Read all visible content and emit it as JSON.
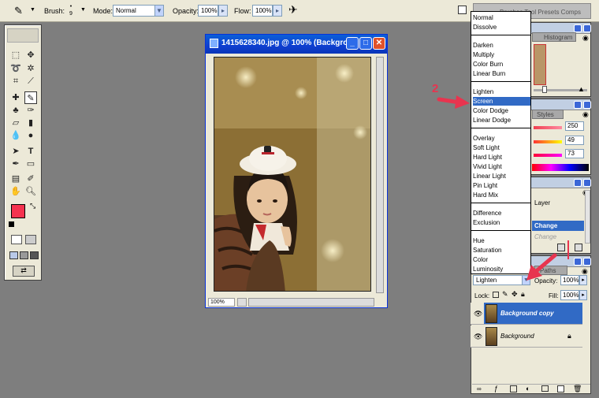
{
  "options_bar": {
    "brush_label": "Brush:",
    "brush_size": "9",
    "mode_label": "Mode:",
    "mode_value": "Normal",
    "opacity_label": "Opacity:",
    "opacity_value": "100%",
    "flow_label": "Flow:",
    "flow_value": "100%",
    "well_tabs": "Brushes  Tool Presets  Comps"
  },
  "image_window": {
    "title": "1415628340.jpg @ 100% (Backgro...",
    "zoom": "100%"
  },
  "panels": {
    "histogram_tab": "Histogram",
    "styles_tab": "Styles",
    "color_values": [
      "250",
      "49",
      "73"
    ],
    "history_items": [
      "Layer",
      "Change",
      "Change"
    ],
    "paths_tab": "Paths"
  },
  "blend_modes": {
    "groups": [
      [
        "Normal",
        "Dissolve"
      ],
      [
        "Darken",
        "Multiply",
        "Color Burn",
        "Linear Burn"
      ],
      [
        "Lighten",
        "Screen",
        "Color Dodge",
        "Linear Dodge"
      ],
      [
        "Overlay",
        "Soft Light",
        "Hard Light",
        "Vivid Light",
        "Linear Light",
        "Pin Light",
        "Hard Mix"
      ],
      [
        "Difference",
        "Exclusion"
      ],
      [
        "Hue",
        "Saturation",
        "Color",
        "Luminosity"
      ]
    ],
    "selected": "Screen"
  },
  "layers": {
    "blend_value": "Lighten",
    "opacity_label": "Opacity:",
    "opacity_value": "100%",
    "lock_label": "Lock:",
    "fill_label": "Fill:",
    "fill_value": "100%",
    "items": [
      "Background copy",
      "Background"
    ]
  },
  "annotation": {
    "number": "2"
  },
  "colors": {
    "foreground": "#f5324f",
    "selection": "#316ac5",
    "annotation": "#e8344f"
  }
}
